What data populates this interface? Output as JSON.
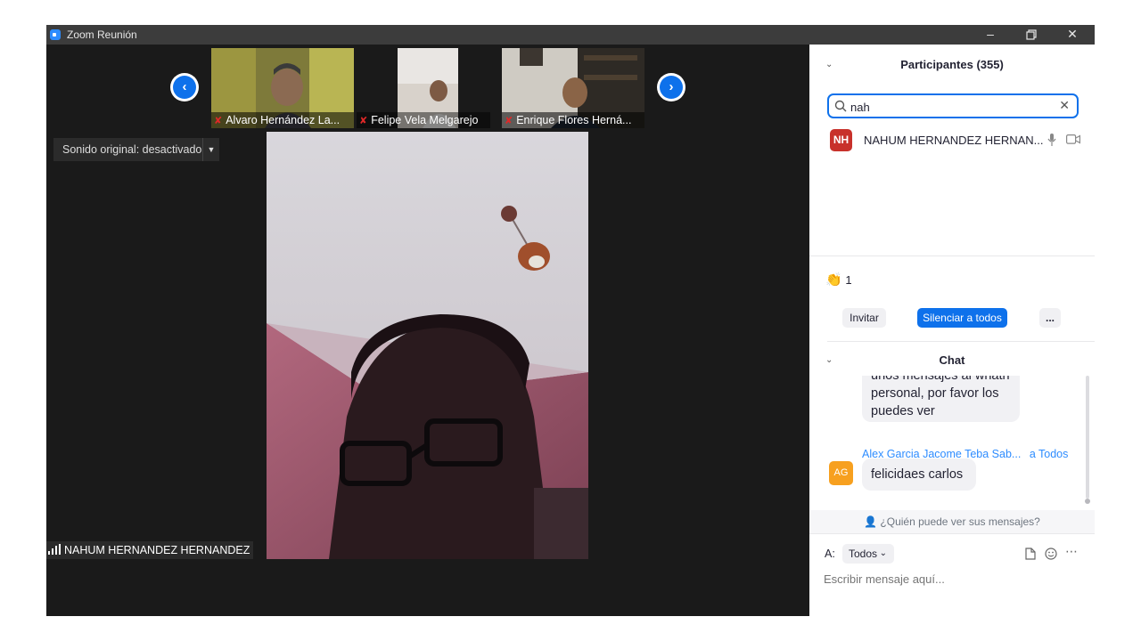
{
  "window": {
    "title": "Zoom Reunión"
  },
  "video": {
    "thumbnails": [
      {
        "name": "Alvaro Hernández La..."
      },
      {
        "name": "Felipe Vela Melgarejo"
      },
      {
        "name": "Enrique Flores Herná..."
      }
    ],
    "sound_dropdown": "Sonido original: desactivado",
    "active_speaker": "NAHUM HERNANDEZ HERNANDEZ"
  },
  "participants": {
    "header": "Participantes (355)",
    "search_value": "nah",
    "results": [
      {
        "initials": "NH",
        "name": "NAHUM HERNANDEZ HERNAN...",
        "avatar_color": "#c8312b"
      }
    ],
    "raised_hands": "1",
    "invite_label": "Invitar",
    "mute_all_label": "Silenciar a todos",
    "more_label": "..."
  },
  "chat": {
    "header": "Chat",
    "messages": [
      {
        "lines": [
          "unos mensajes al whath",
          "personal, por favor los",
          "puedes ver"
        ]
      }
    ],
    "last_sender": "Alex Garcia Jacome Teba Sab...",
    "last_recipient": "a Todos",
    "last_initials": "AG",
    "last_avatar_color": "#f7a01f",
    "last_text": "felicidaes carlos",
    "visibility_note": "¿Quién puede ver sus mensajes?",
    "to_label": "A:",
    "to_value": "Todos",
    "placeholder": "Escribir mensaje aquí..."
  },
  "colors": {
    "accent": "#0e71eb",
    "link": "#2d8cff"
  }
}
